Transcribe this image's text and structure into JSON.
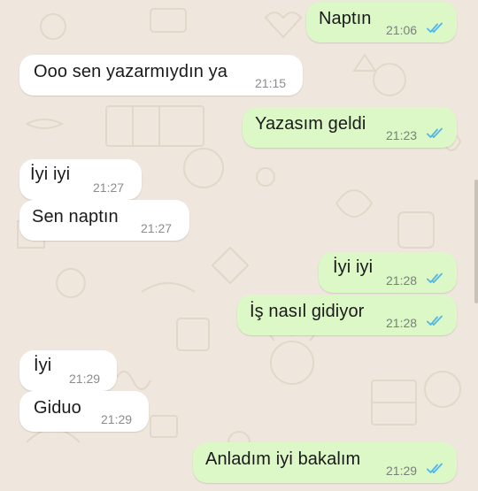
{
  "colors": {
    "wallpaper": "#efe7dd",
    "outgoing_bubble": "#dcf8c6",
    "incoming_bubble": "#ffffff",
    "read_tick": "#4fb6ec"
  },
  "messages": [
    {
      "text": "Naptın",
      "time": "21:06",
      "direction": "outgoing",
      "status": "read-double-check-icon"
    },
    {
      "text": "Ooo sen yazarmıydın ya",
      "time": "21:15",
      "direction": "incoming"
    },
    {
      "text": "Yazasım geldi",
      "time": "21:23",
      "direction": "outgoing",
      "status": "read-double-check-icon"
    },
    {
      "text": "İyi iyi",
      "time": "21:27",
      "direction": "incoming"
    },
    {
      "text": "Sen naptın",
      "time": "21:27",
      "direction": "incoming"
    },
    {
      "text": "İyi iyi",
      "time": "21:28",
      "direction": "outgoing",
      "status": "read-double-check-icon"
    },
    {
      "text": "İş nasıl gidiyor",
      "time": "21:28",
      "direction": "outgoing",
      "status": "read-double-check-icon"
    },
    {
      "text": "İyi",
      "time": "21:29",
      "direction": "incoming"
    },
    {
      "text": "Giduo",
      "time": "21:29",
      "direction": "incoming"
    },
    {
      "text": "Anladım iyi bakalım",
      "time": "21:29",
      "direction": "outgoing",
      "status": "read-double-check-icon"
    }
  ]
}
